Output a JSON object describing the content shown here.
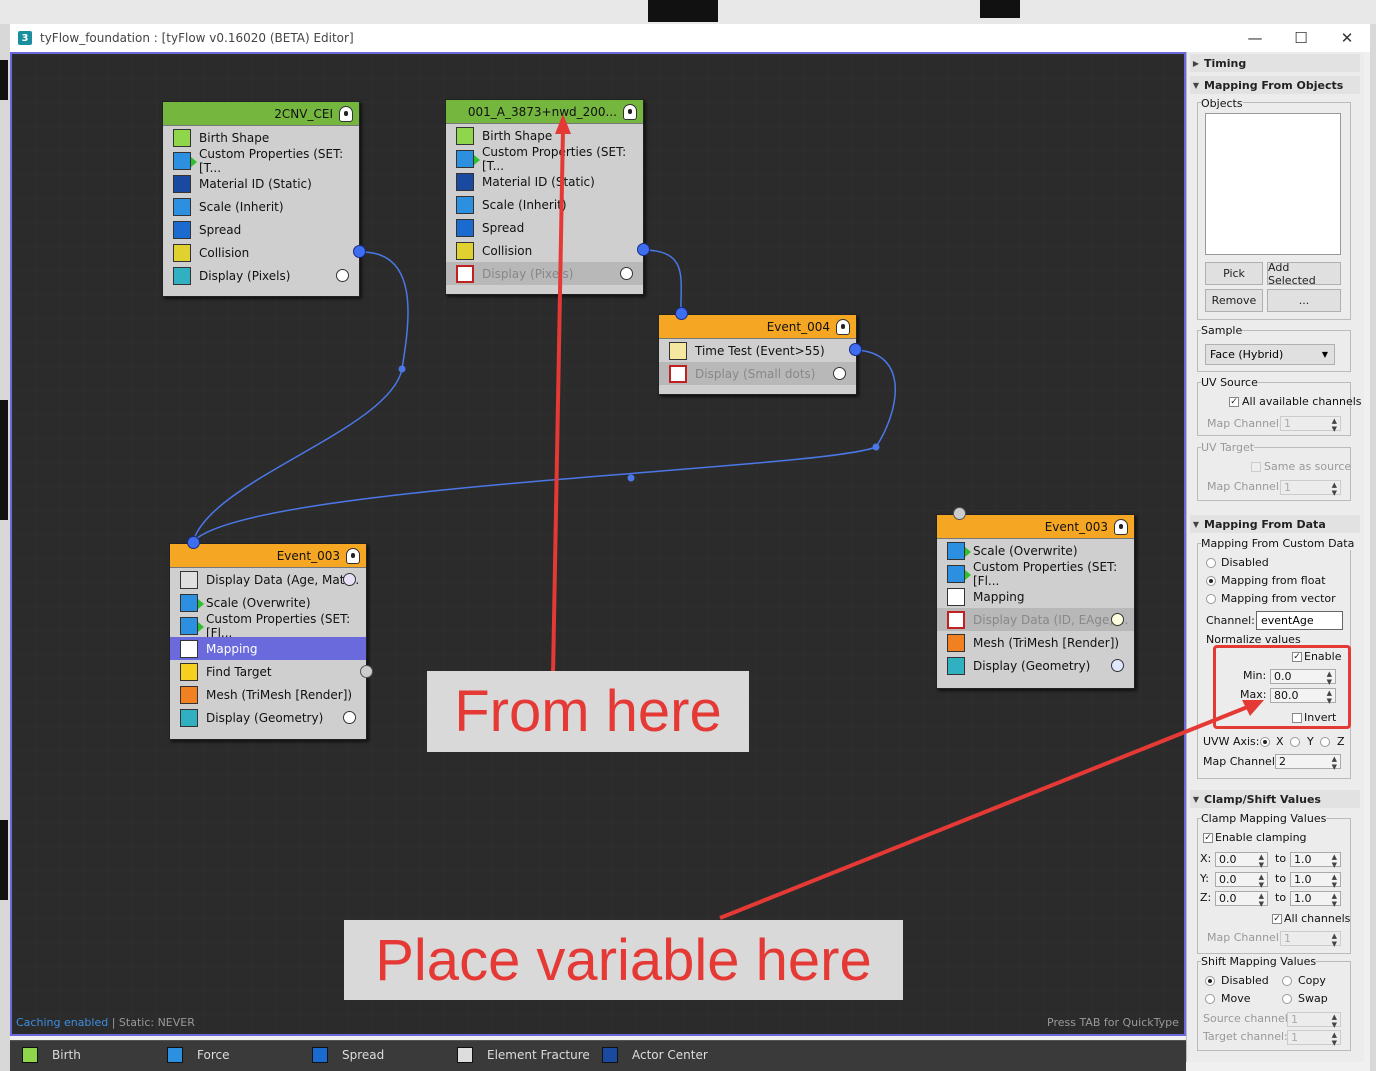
{
  "window": {
    "title": "tyFlow_foundation : [tyFlow v0.16020 (BETA) Editor]",
    "logo": "3"
  },
  "editor": {
    "status_cache": "Caching enabled",
    "status_static": " | Static: NEVER",
    "quicktype": "Press TAB for QuickType",
    "nodes": {
      "n1": {
        "title": "2CNV_CEI",
        "ops": [
          "Birth Shape",
          "Custom Properties (SET: [T...",
          "Material ID (Static)",
          "Scale (Inherit)",
          "Spread",
          "Collision",
          "Display (Pixels)"
        ]
      },
      "n2": {
        "title": "001_A_3873+nwd_200...",
        "ops": [
          "Birth Shape",
          "Custom Properties (SET: [T...",
          "Material ID (Static)",
          "Scale (Inherit)",
          "Spread",
          "Collision",
          "Display (Pixels)"
        ]
      },
      "n3": {
        "title": "Event_004",
        "ops": [
          "Time Test (Event>55)",
          "Display (Small dots)"
        ]
      },
      "n4": {
        "title": "Event_003",
        "ops": [
          "Display Data (Age, Matl...",
          "Scale (Overwrite)",
          "Custom Properties (SET: [Fl...",
          "Mapping",
          "Find Target",
          "Mesh (TriMesh [Render])",
          "Display (Geometry)"
        ]
      },
      "n5": {
        "title": "Event_003",
        "ops": [
          "Scale (Overwrite)",
          "Custom Properties (SET: [Fl...",
          "Mapping",
          "Display Data (ID, EAge, ...",
          "Mesh (TriMesh [Render])",
          "Display (Geometry)"
        ]
      }
    }
  },
  "annotations": {
    "from": "From here",
    "place": "Place variable here",
    "color": "#e53935"
  },
  "panel": {
    "timing": "Timing",
    "mfo": {
      "title": "Mapping From Objects",
      "objects_label": "Objects",
      "pick": "Pick",
      "add_selected": "Add Selected",
      "remove": "Remove",
      "more": "...",
      "sample_label": "Sample",
      "sample_value": "Face (Hybrid)",
      "uv_source": "UV Source",
      "all_channels": "All available channels",
      "map_channel": "Map Channel:",
      "map_channel_val": "1",
      "uv_target": "UV Target",
      "same_as_source": "Same as source",
      "map_channel2": "Map Channel:",
      "map_channel2_val": "1"
    },
    "mfd": {
      "title": "Mapping From Data",
      "mfcd": "Mapping From Custom Data",
      "disabled": "Disabled",
      "from_float": "Mapping from float",
      "from_vector": "Mapping from vector",
      "channel_label": "Channel:",
      "channel_value": "eventAge",
      "normalize": "Normalize values",
      "enable": "Enable",
      "min_label": "Min:",
      "min_val": "0.0",
      "max_label": "Max:",
      "max_val": "80.0",
      "invert": "Invert",
      "uvw_axis": "UVW Axis:",
      "ax_x": "X",
      "ax_y": "Y",
      "ax_z": "Z",
      "map_channel": "Map Channel:",
      "map_channel_val": "2"
    },
    "csv": {
      "title": "Clamp/Shift Values",
      "clamp_label": "Clamp Mapping Values",
      "enable_clamping": "Enable clamping",
      "x_label": "X:",
      "y_label": "Y:",
      "z_label": "Z:",
      "to": "to",
      "x_from": "0.0",
      "x_to": "1.0",
      "y_from": "0.0",
      "y_to": "1.0",
      "z_from": "0.0",
      "z_to": "1.0",
      "all_channels": "All channels",
      "map_channel": "Map Channel:",
      "map_channel_val": "1",
      "shift_label": "Shift Mapping Values",
      "disabled": "Disabled",
      "copy": "Copy",
      "move": "Move",
      "swap": "Swap",
      "source_channel": "Source channel:",
      "source_val": "1",
      "target_channel": "Target channel:",
      "target_val": "1"
    }
  },
  "toolbar": {
    "birth": "Birth",
    "force": "Force",
    "spread": "Spread",
    "element_fracture": "Element Fracture",
    "actor_center": "Actor Center"
  }
}
